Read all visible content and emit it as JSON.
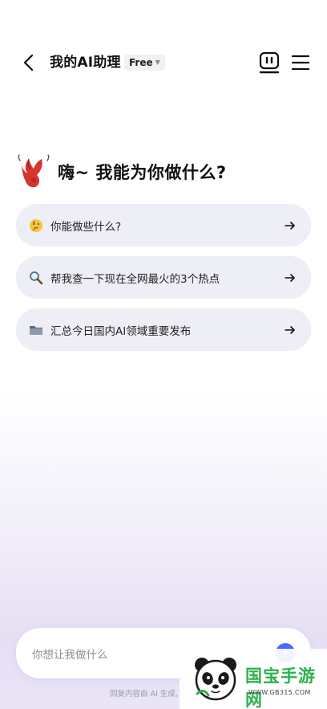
{
  "header": {
    "title": "我的AI助理",
    "plan_badge": "Free",
    "icons": [
      "back-arrow",
      "bot",
      "menu"
    ]
  },
  "greeting": {
    "text": "嗨~ 我能为你做什么?",
    "icon": "lobster-claw"
  },
  "suggestions": [
    {
      "emoji": "thinking-face",
      "label": "你能做些什么?"
    },
    {
      "emoji": "magnifier",
      "label": "帮我查一下现在全网最火的3个热点"
    },
    {
      "emoji": "folder",
      "label": "汇总今日国内AI领域重要发布"
    }
  ],
  "input": {
    "placeholder": "你想让我做什么"
  },
  "disclaimer": "回复内容由 AI 生成,",
  "watermark": {
    "brand": "国宝手游网",
    "domain": "WWW.GB315.COM"
  },
  "colors": {
    "accent": "#4a69ff",
    "card": "#eeeef6",
    "claw": "#d6362f",
    "watermark_green": "#2bb24c"
  }
}
